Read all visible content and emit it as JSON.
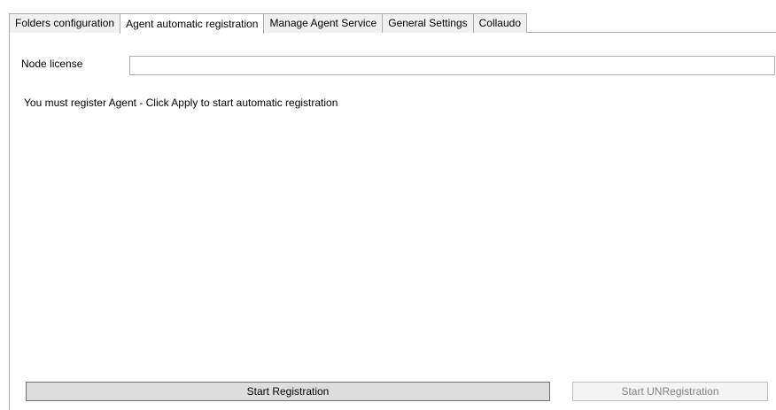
{
  "tabs": [
    {
      "label": "Folders configuration",
      "selected": false
    },
    {
      "label": "Agent automatic registration",
      "selected": true
    },
    {
      "label": "Manage Agent Service",
      "selected": false
    },
    {
      "label": "General Settings",
      "selected": false
    },
    {
      "label": "Collaudo",
      "selected": false
    }
  ],
  "registration": {
    "node_license_label": "Node license",
    "node_license_value": "",
    "message": "You must register Agent - Click Apply to start automatic registration",
    "start_button_label": "Start Registration",
    "unregister_button_label": "Start UNRegistration",
    "unregister_enabled": false
  }
}
